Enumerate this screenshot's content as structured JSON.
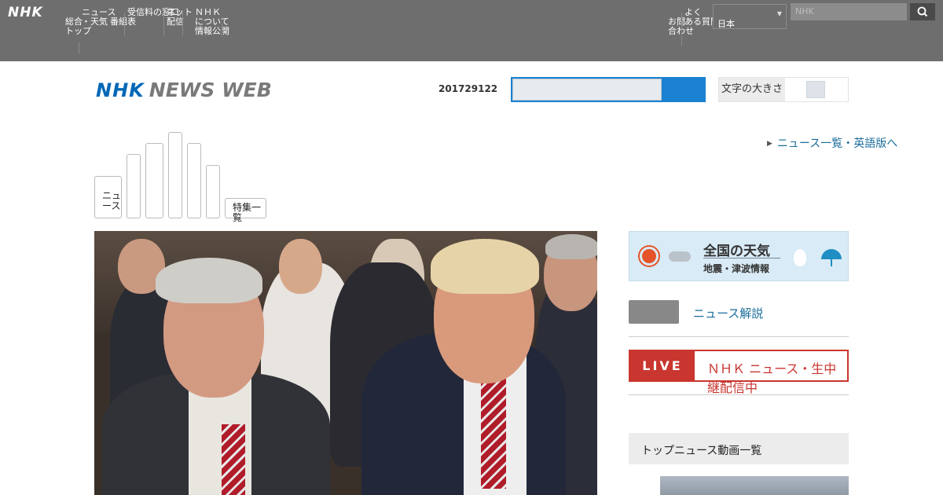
{
  "topbar": {
    "logo": "NHK",
    "nav_items": [
      "総合\nトップ",
      "ニュース\n・天気",
      "番組表",
      "受信料の窓口",
      "ネット\n配信",
      "ＮＨＫ\nについて\n情報公開"
    ],
    "right_items": [
      "お問\n合わせ",
      "よく\nある質問"
    ],
    "language": "日本",
    "search_placeholder": "NHK"
  },
  "header": {
    "brand_nhk": "NHK",
    "brand_news": "NEWS WEB",
    "date": "201729122",
    "toggle_label": "文字の大きさ"
  },
  "links": {
    "top_right": "ニュース一覧・英語版へ"
  },
  "subnav": {
    "first": "ニュ\nース",
    "last": "特集一覧"
  },
  "right": {
    "weather_title": "全国の天気",
    "weather_sub": "地震・津波情報",
    "link": "ニュース解説",
    "live_tag": "LIVE",
    "live_text": "ＮＨＫ ニュース・生中継配信中",
    "section_title": "トップニュース動画一覧"
  },
  "colors": {
    "topbar": "#6e6e6e",
    "brand_blue": "#0068b7",
    "live_red": "#c9362f",
    "search_blue": "#1a82d0"
  }
}
